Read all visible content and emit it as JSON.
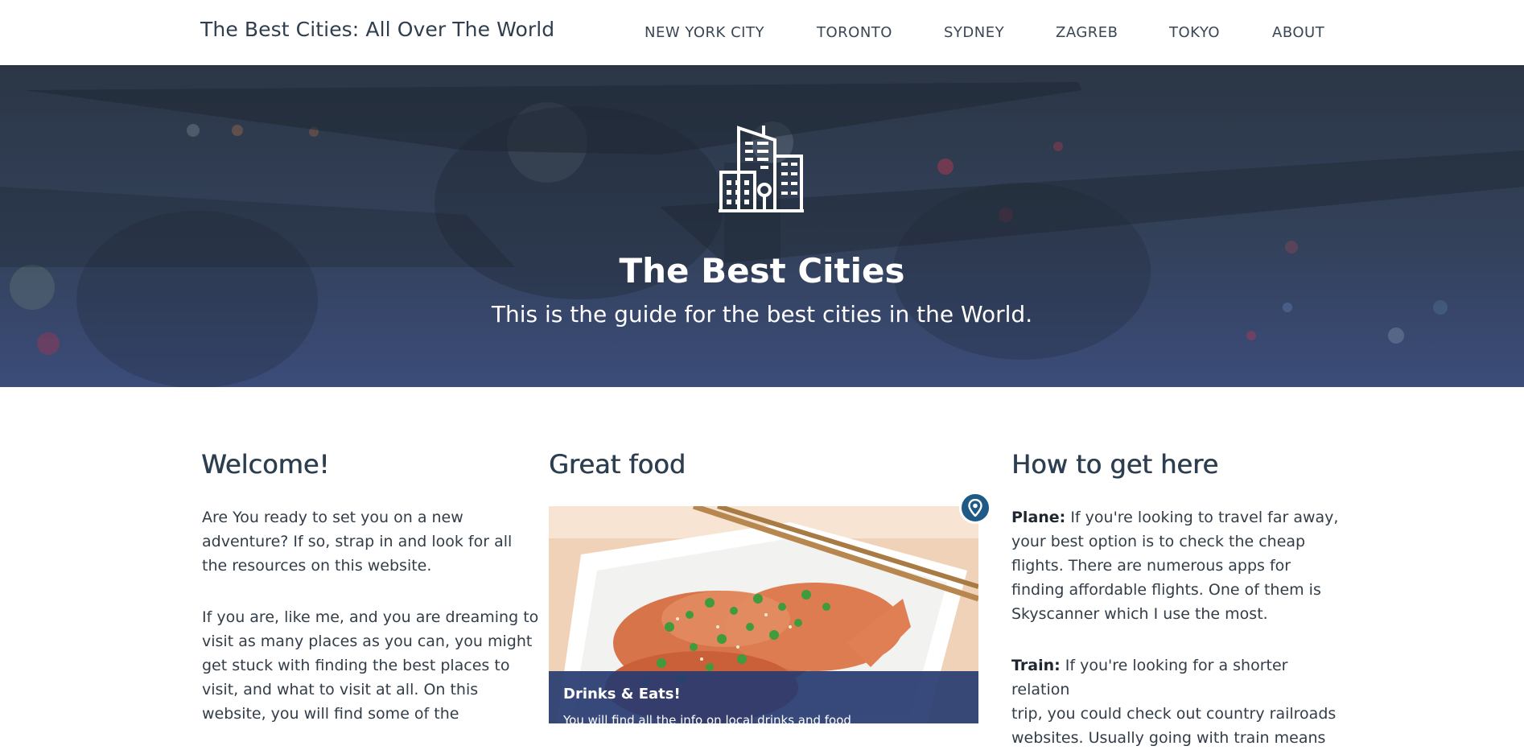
{
  "site": {
    "brand": "The Best Cities: All Over The World"
  },
  "nav": {
    "items": [
      {
        "label": "NEW YORK CITY"
      },
      {
        "label": "TORONTO"
      },
      {
        "label": "SYDNEY"
      },
      {
        "label": "ZAGREB"
      },
      {
        "label": "TOKYO"
      },
      {
        "label": "ABOUT"
      }
    ]
  },
  "hero": {
    "icon": "city-buildings-icon",
    "title": "The Best Cities",
    "subtitle": "This is the guide for the best cities in the World."
  },
  "welcome": {
    "heading": "Welcome!",
    "para1_lines": [
      "Are You ready to set you on a new",
      "adventure? If so, strap in and look for all",
      "the resources on this website."
    ],
    "para2_lines": [
      "If you are, like me, and you are dreaming to",
      "visit as many places as you can, you might",
      "get stuck with finding the best places to",
      "visit, and what to visit at all. On this",
      "website, you will find some of the"
    ]
  },
  "food": {
    "heading": "Great food",
    "pin_icon": "map-pin-icon",
    "image": "salmon-dish-image",
    "caption_title": "Drinks & Eats!",
    "caption_text": "You will find all the info on local drinks and food"
  },
  "travel": {
    "heading": "How to get here",
    "plane_label": "Plane:",
    "plane_lines": [
      " If you're looking to travel far away,",
      "your best option is to check the cheap",
      "flights. There are numerous apps for",
      "finding affordable flights. One of them is",
      "Skyscanner which I use the most."
    ],
    "train_label": "Train:",
    "train_lines": [
      " If you're looking for a shorter relation",
      "trip, you could check out country railroads",
      "websites. Usually going with train means"
    ]
  },
  "colors": {
    "heading": "#2c3e50",
    "hero_overlay": "#33415a",
    "caption_bg": "#273b70",
    "pin": "#1f5a86"
  }
}
